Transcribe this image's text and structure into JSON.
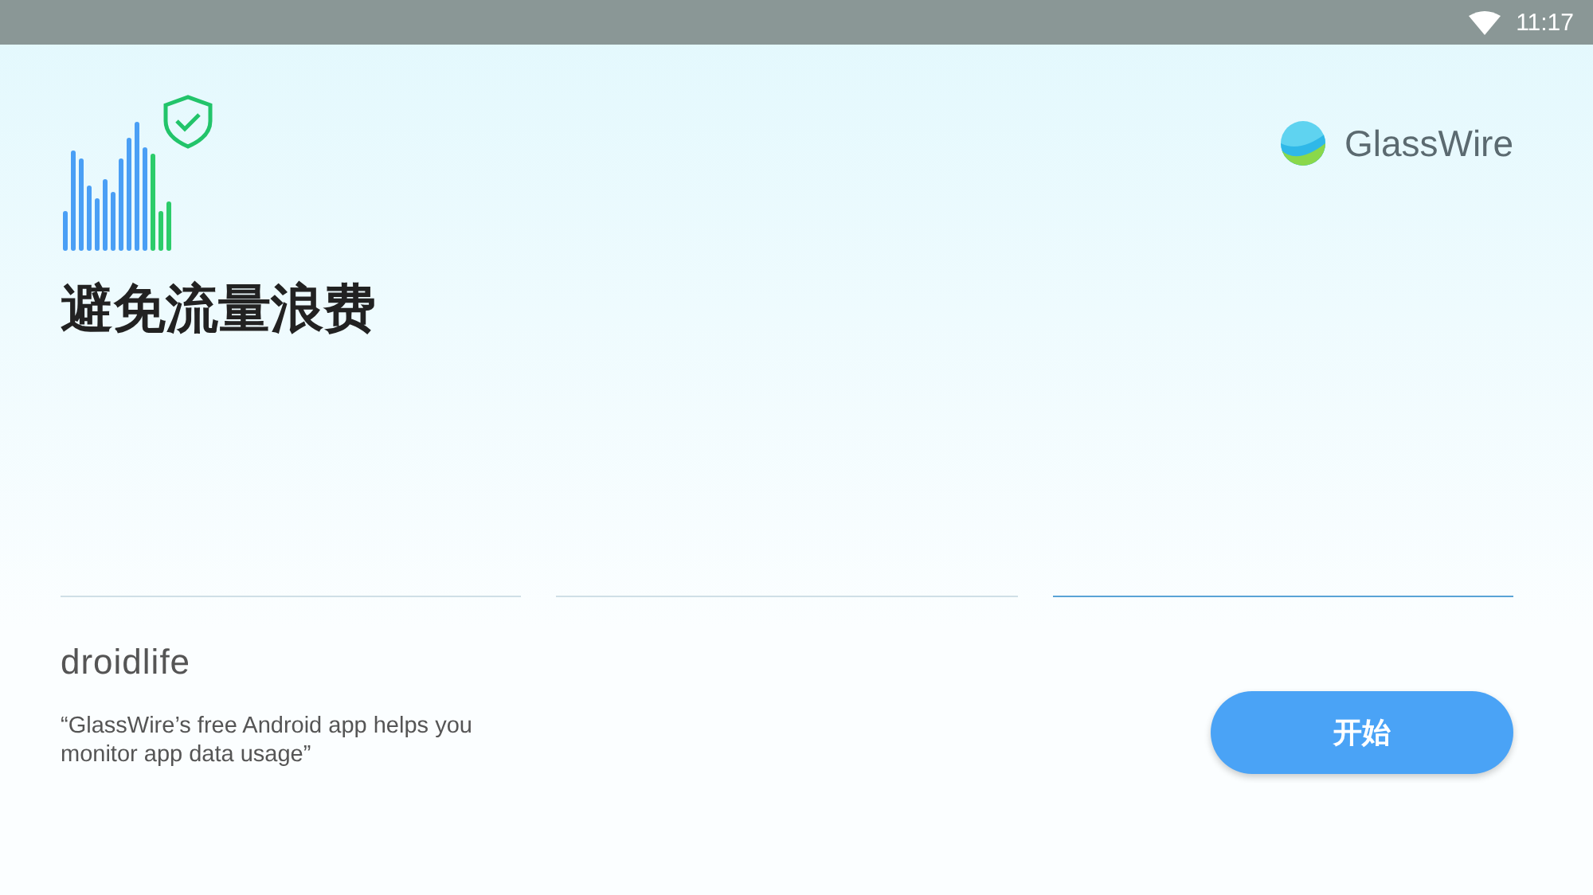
{
  "status_bar": {
    "time": "11:17"
  },
  "brand": {
    "name": "GlassWire"
  },
  "headline": "避免流量浪费",
  "pager": [
    {
      "selected": false
    },
    {
      "selected": false
    },
    {
      "selected": true
    }
  ],
  "press": {
    "source": "droidlife",
    "quote": "“GlassWire’s free Android app helps you monitor app data usage”"
  },
  "start_button": {
    "label": "开始"
  }
}
